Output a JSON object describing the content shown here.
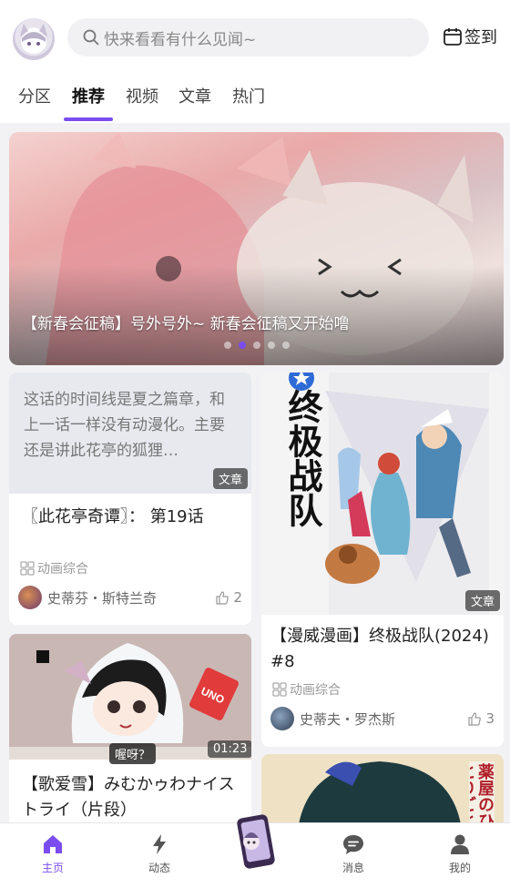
{
  "header": {
    "search_placeholder": "快来看看有什么见闻~",
    "signin_label": "签到"
  },
  "tabs": [
    {
      "label": "分区"
    },
    {
      "label": "推荐"
    },
    {
      "label": "视频"
    },
    {
      "label": "文章"
    },
    {
      "label": "热门"
    }
  ],
  "banner": {
    "caption": "【新春会征稿】号外号外~ 新春会征稿又开始噜",
    "active_dot": 2,
    "dot_count": 5
  },
  "feed": {
    "card1": {
      "preview": "这话的时间线是夏之篇章，和上一话一样没有动漫化。主要还是讲此花亭的狐狸…",
      "badge": "文章",
      "title": "〖此花亭奇谭〗：  第19话",
      "category": "动画综合",
      "author": "史蒂芬・斯特兰奇",
      "likes": "2"
    },
    "card2": {
      "cover_text": "终极战队",
      "badge": "文章",
      "title": "【漫威漫画】终极战队(2024) #8",
      "category": "动画综合",
      "author": "史蒂夫・罗杰斯",
      "likes": "3"
    },
    "card3": {
      "duration": "01:23",
      "subtitle": "喔呀？",
      "card_text": "UNO",
      "title": "【歌爱雪】みむかゥわナイストライ（片段）"
    },
    "card4": {
      "cover_text": "薬屋のひとりごと"
    }
  },
  "bottom_nav": [
    {
      "label": "主页",
      "icon": "home-icon"
    },
    {
      "label": "动态",
      "icon": "lightning-icon"
    },
    {
      "label": "消息",
      "icon": "message-icon"
    },
    {
      "label": "我的",
      "icon": "user-icon"
    }
  ],
  "colors": {
    "accent": "#7b4df0",
    "background": "#f2f2f4"
  }
}
